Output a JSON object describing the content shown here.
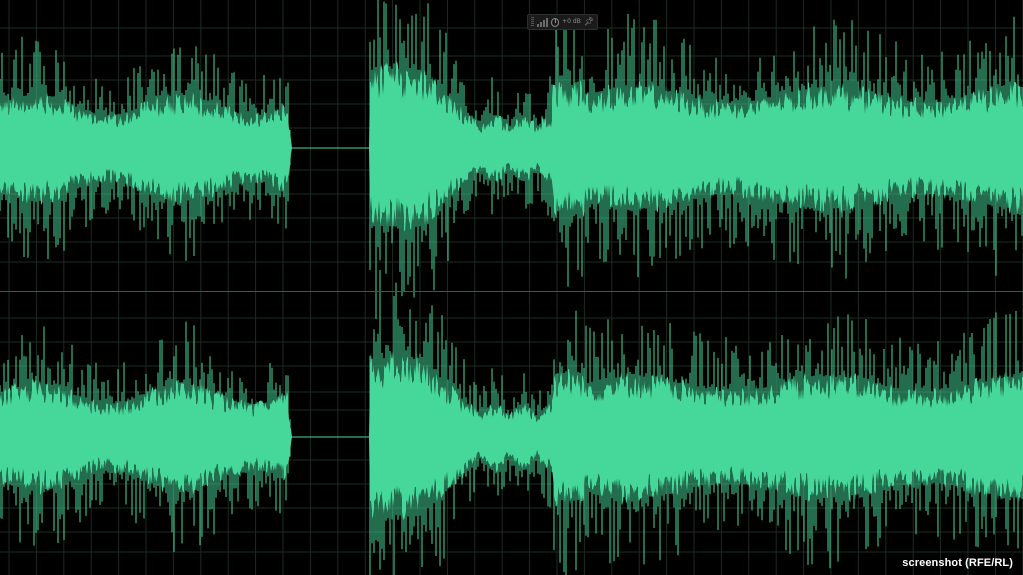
{
  "editor": {
    "view": "stereo waveform",
    "channels": [
      "left",
      "right"
    ],
    "background_color": "#000000",
    "waveform_color": "#46d89a",
    "grid_color": "#1d2b24",
    "divider_color": "#3c5a48"
  },
  "hud": {
    "level_icon": "level-meter-icon",
    "knob_icon": "volume-knob-icon",
    "volume_value": "+0 dB",
    "pin_icon": "pin-icon"
  },
  "credit": {
    "text": "screenshot (RFE/RL)"
  }
}
